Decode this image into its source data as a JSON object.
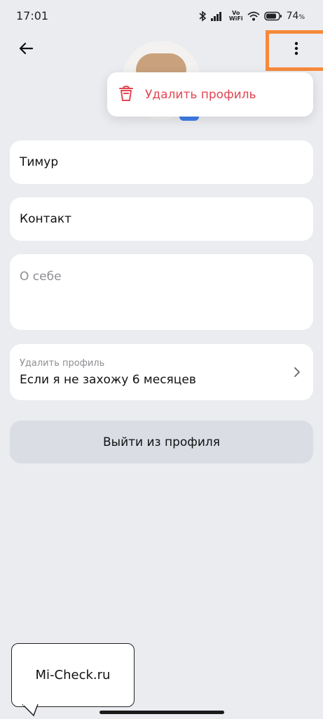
{
  "status_bar": {
    "time": "17:01",
    "vowifi_top": "Vo",
    "vowifi_bottom": "WiFi",
    "battery_percent": "74",
    "battery_unit": "%"
  },
  "header": {
    "back_icon": "arrow-left-icon",
    "more_icon": "more-vertical-icon",
    "highlight_color": "#f7893a"
  },
  "popup_menu": {
    "items": [
      {
        "label": "Удалить профиль",
        "icon": "trash-icon",
        "color": "#e24653"
      }
    ]
  },
  "form": {
    "name_value": "Тимур",
    "contact_value": "Контакт",
    "about_placeholder": "О себе",
    "delete_setting": {
      "label": "Удалить профиль",
      "value": "Если я не захожу 6 месяцев"
    }
  },
  "actions": {
    "logout_label": "Выйти из профиля"
  },
  "watermark": {
    "text": "Mi-Check.ru"
  },
  "colors": {
    "background": "#ebecf0",
    "danger": "#e24653",
    "accent": "#3f7ee8"
  }
}
